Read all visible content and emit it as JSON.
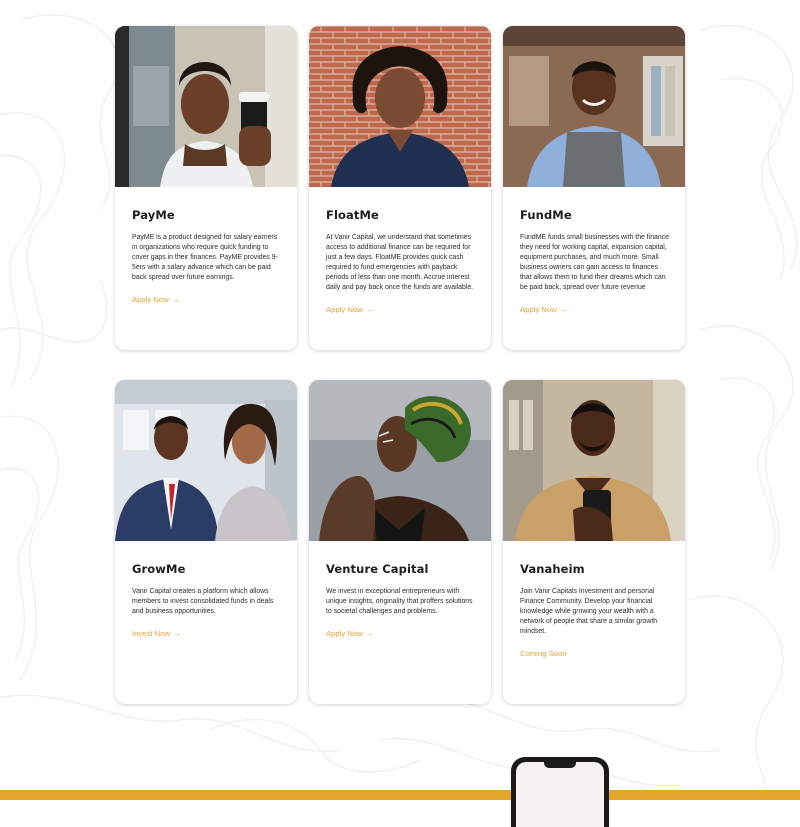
{
  "products": [
    {
      "id": "payme",
      "title": "PayMe",
      "description": "PayME is a product designed for salary earners in organizations who require quick funding to cover gaps in their finances. PayME provides 9-5ers with a salary advance which can be paid back spread over future earnings.",
      "action": "Apply Now",
      "arrow": "→",
      "photo": "woman-holding-coffee-cup-photo"
    },
    {
      "id": "floatme",
      "title": "FloatMe",
      "description": "At Vanir Capital, we understand that sometimes access to additional finance can be required for just a few days. FloatME provides quick cash required to fund emergencies with payback periods of less than one month. Accrue interest daily and pay back once the funds are available.",
      "action": "Apply Now",
      "arrow": "→",
      "photo": "woman-arms-crossed-brick-wall-photo"
    },
    {
      "id": "fundme",
      "title": "FundMe",
      "description": "FundME funds small businesses with the finance they need for working capital, expansion capital, equipment purchases, and much more. Small business owners can gain access to finances that allows them to fund their dreams which can be paid back, spread over future revenue",
      "action": "Apply Now",
      "arrow": "→",
      "photo": "shop-owner-apron-photo"
    },
    {
      "id": "growme",
      "title": "GrowMe",
      "description": "Vanir Capital creates a platform which allows members to invest consolidated funds in deals and business opportunities.",
      "action": "Invest Now",
      "arrow": "→",
      "photo": "business-couple-photo"
    },
    {
      "id": "venture-capital",
      "title": "Venture Capital",
      "description": "We invest in exceptional entrepreneurs with unique insights, originality that proffers solutions to societal challenges and problems.",
      "action": "Apply Now",
      "arrow": "→",
      "photo": "woman-head-wrap-photo"
    },
    {
      "id": "vanaheim",
      "title": "Vanaheim",
      "description": "Join Vanir Capitals Investment and personal Finance Community. Develop your financial knowledge while growing your wealth with a network of people that share a similar growth mindset.",
      "action": "Coming Soon",
      "arrow": "",
      "photo": "man-using-phone-photo"
    }
  ],
  "colors": {
    "accent": "#e1a43b",
    "footer_band": "#e6a52f",
    "title_text": "#1e1e1e",
    "body_text": "#2c2c2c"
  }
}
